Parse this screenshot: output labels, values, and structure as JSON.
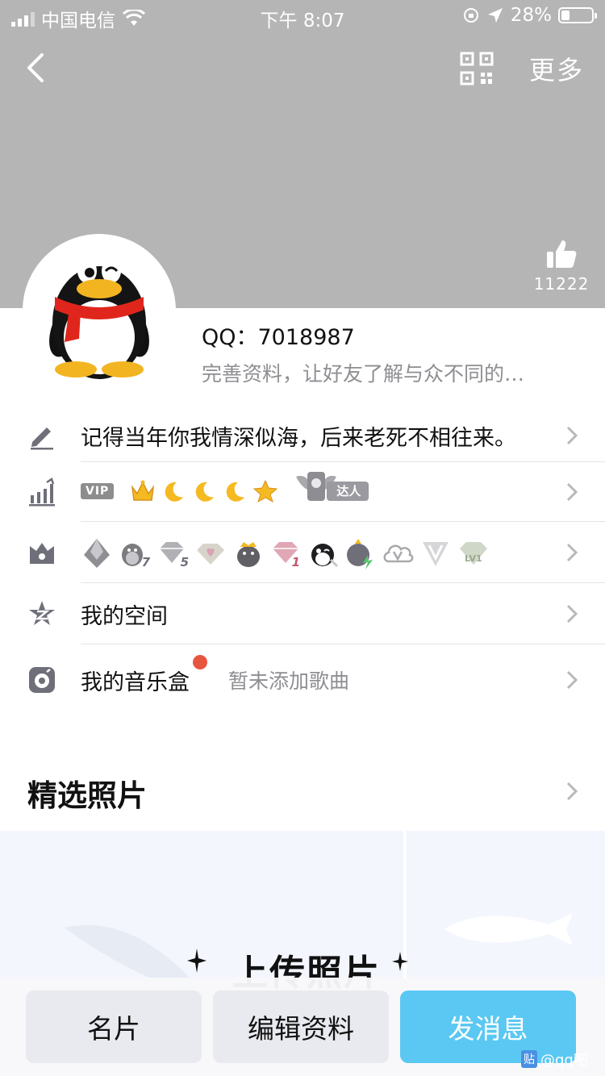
{
  "status_bar": {
    "carrier": "中国电信",
    "time": "下午 8:07",
    "battery_percent": "28%"
  },
  "header": {
    "more_label": "更多",
    "like_count": "11222"
  },
  "profile": {
    "qq_number": "QQ：7018987",
    "signature_placeholder": "完善资料，让好友了解与众不同的…"
  },
  "rows": {
    "signature": "记得当年你我情深似海，后来老死不相往来。",
    "vip_tag": "VIP",
    "master_tag": "达人",
    "qzone": "我的空间",
    "music_box": "我的音乐盒",
    "music_note": "暂未添加歌曲"
  },
  "badges": {
    "b7": "7",
    "b5": "5",
    "b1": "1",
    "lv": "LV1"
  },
  "photos": {
    "title": "精选照片",
    "upload_label": "上传照片"
  },
  "actions": {
    "card": "名片",
    "edit": "编辑资料",
    "message": "发消息"
  },
  "watermark": {
    "logo": "贴",
    "text": "@qq吧"
  },
  "colors": {
    "header_bg": "#b5b5b5",
    "primary_button": "#5ac8f3",
    "notification_dot": "#e8553f",
    "icon_gray": "#6e6f79"
  }
}
